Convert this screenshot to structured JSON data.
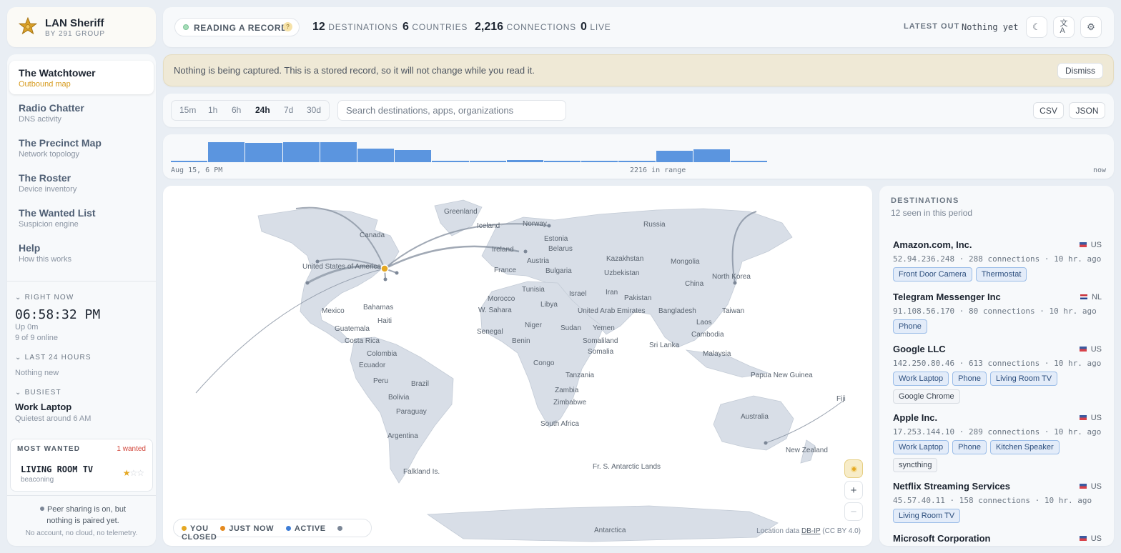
{
  "brand": {
    "title": "LAN Sheriff",
    "subtitle": "BY 291 GROUP"
  },
  "nav": [
    {
      "label": "The Watchtower",
      "sub": "Outbound map",
      "active": true
    },
    {
      "label": "Radio Chatter",
      "sub": "DNS activity"
    },
    {
      "label": "The Precinct Map",
      "sub": "Network topology"
    },
    {
      "label": "The Roster",
      "sub": "Device inventory"
    },
    {
      "label": "The Wanted List",
      "sub": "Suspicion engine"
    },
    {
      "label": "Help",
      "sub": "How this works"
    }
  ],
  "right_now": {
    "head": "RIGHT NOW",
    "clock": "06:58:32 PM",
    "uptime": "Up 0m",
    "online": "9 of 9 online"
  },
  "last24": {
    "head": "LAST 24 HOURS",
    "text": "Nothing new"
  },
  "busiest": {
    "head": "BUSIEST",
    "device": "Work Laptop",
    "note": "Quietest around 6 AM"
  },
  "most_wanted": {
    "head": "MOST WANTED",
    "count": "1 wanted",
    "device": "LIVING ROOM TV",
    "status": "beaconing",
    "stars": 1,
    "max_stars": 3
  },
  "peer": {
    "text": "Peer sharing is on, but nothing is paired yet.",
    "footer": "No account, no cloud, no telemetry."
  },
  "topbar": {
    "mode": "READING A RECORD",
    "help": "?",
    "destinations": "12",
    "destinations_label": "DESTINATIONS",
    "countries": "6",
    "countries_label": "COUNTRIES",
    "connections": "2,216",
    "connections_label": "CONNECTIONS",
    "live": "0",
    "live_label": "LIVE",
    "latest_label": "LATEST OUT",
    "latest_value": "Nothing yet",
    "theme_icon": "moon-icon",
    "lang_icon": "translate-icon",
    "settings_icon": "gear-icon"
  },
  "banner": {
    "message": "Nothing is being captured. This is a stored record, so it will not change while you read it.",
    "dismiss": "Dismiss"
  },
  "controls": {
    "ranges": [
      "15m",
      "1h",
      "6h",
      "24h",
      "7d",
      "30d"
    ],
    "selected": "24h",
    "search_placeholder": "Search destinations, apps, organizations",
    "csv": "CSV",
    "json": "JSON"
  },
  "timeline": {
    "start": "Aug 15, 6 PM",
    "summary": "2216 in range",
    "end": "now",
    "bars": [
      0.05,
      1.0,
      0.98,
      1.0,
      0.99,
      0.68,
      0.62,
      0.05,
      0.06,
      0.09,
      0.06,
      0.08,
      0.07,
      0.58,
      0.63,
      0.04,
      0,
      0,
      0,
      0,
      0,
      0,
      0,
      0,
      0,
      0
    ]
  },
  "map": {
    "labels": [
      "Greenland",
      "Iceland",
      "Norway",
      "Russia",
      "Canada",
      "Estonia",
      "Belarus",
      "Ireland",
      "Kazakhstan",
      "Austria",
      "Mongolia",
      "United States of America",
      "France",
      "Bulgaria",
      "Uzbekistan",
      "North Korea",
      "China",
      "Tunisia",
      "Israel",
      "Iran",
      "Pakistan",
      "Morocco",
      "Libya",
      "W. Sahara",
      "United Arab Emirates",
      "Bangladesh",
      "Taiwan",
      "Mexico",
      "Bahamas",
      "Haiti",
      "Guatemala",
      "Costa Rica",
      "Senegal",
      "Niger",
      "Sudan",
      "Yemen",
      "Laos",
      "Cambodia",
      "Benin",
      "Somaliland",
      "Somalia",
      "Sri Lanka",
      "Malaysia",
      "Colombia",
      "Ecuador",
      "Congo",
      "Tanzania",
      "Papua New Guinea",
      "Peru",
      "Brazil",
      "Bolivia",
      "Zambia",
      "Zimbabwe",
      "Fiji",
      "Paraguay",
      "Australia",
      "South Africa",
      "Argentina",
      "New Zealand",
      "Falkland Is.",
      "Fr. S. Antarctic Lands",
      "Antarctica"
    ],
    "legend": [
      "YOU",
      "JUST NOW",
      "ACTIVE",
      "CLOSED"
    ],
    "legend_colors": [
      "#e5a823",
      "#e58a1f",
      "#3e7dd6",
      "#7c8797"
    ],
    "attribution_prefix": "Location data",
    "attribution_link": "DB-IP",
    "attribution_suffix": "(CC BY 4.0)",
    "zoom_in": "+",
    "zoom_out": "−"
  },
  "destinations": {
    "heading": "DESTINATIONS",
    "subheading": "12 seen in this period",
    "items": [
      {
        "name": "Amazon.com, Inc.",
        "country": "US",
        "meta": "52.94.236.248 · 288 connections · 10 hr. ago",
        "tags": [
          [
            "Front Door Camera",
            "dev"
          ],
          [
            "Thermostat",
            "dev"
          ]
        ]
      },
      {
        "name": "Telegram Messenger Inc",
        "country": "NL",
        "meta": "91.108.56.170 · 80 connections · 10 hr. ago",
        "tags": [
          [
            "Phone",
            "dev"
          ]
        ]
      },
      {
        "name": "Google LLC",
        "country": "US",
        "meta": "142.250.80.46 · 613 connections · 10 hr. ago",
        "tags": [
          [
            "Work Laptop",
            "dev"
          ],
          [
            "Phone",
            "dev"
          ],
          [
            "Living Room TV",
            "dev"
          ],
          [
            "Google Chrome",
            "app"
          ]
        ]
      },
      {
        "name": "Apple Inc.",
        "country": "US",
        "meta": "17.253.144.10 · 289 connections · 10 hr. ago",
        "tags": [
          [
            "Work Laptop",
            "dev"
          ],
          [
            "Phone",
            "dev"
          ],
          [
            "Kitchen Speaker",
            "dev"
          ],
          [
            "syncthing",
            "app"
          ]
        ]
      },
      {
        "name": "Netflix Streaming Services",
        "country": "US",
        "meta": "45.57.40.11 · 158 connections · 10 hr. ago",
        "tags": [
          [
            "Living Room TV",
            "dev"
          ]
        ]
      },
      {
        "name": "Microsoft Corporation",
        "country": "US",
        "meta": "",
        "tags": []
      }
    ]
  }
}
